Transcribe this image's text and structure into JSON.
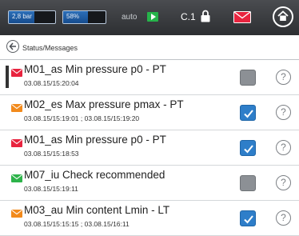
{
  "topbar": {
    "gauge1": {
      "label": "2,8 bar",
      "fill": 0.55
    },
    "gauge2": {
      "label": "58%",
      "fill": 0.58
    },
    "mode_label": "auto",
    "code_label": "C.1",
    "icons": [
      "play-icon",
      "lock-icon",
      "mail-alert-icon",
      "home-icon"
    ],
    "colors": {
      "bar": "#3a3c40",
      "gauge_fill": "#1e5aa2",
      "auto_green": "#26b34a",
      "alert_red": "#e8243f"
    }
  },
  "status": {
    "title": "Status/Messages"
  },
  "messages": [
    {
      "title": "M01_as Min pressure p0 - PT",
      "time": "03.08.15/15:20:04",
      "envelope": "red",
      "acknowledged": false,
      "selected": true
    },
    {
      "title": "M02_es Max pressure pmax - PT",
      "time": "03.08.15/15:19:01 ; 03.08.15/15:19:20",
      "envelope": "orange",
      "acknowledged": true,
      "selected": false
    },
    {
      "title": "M01_as Min pressure p0 - PT",
      "time": "03.08.15/15:18:53",
      "envelope": "red",
      "acknowledged": true,
      "selected": false
    },
    {
      "title": "M07_iu Check recommended",
      "time": "03.08.15/15:19:11",
      "envelope": "green",
      "acknowledged": false,
      "selected": false
    },
    {
      "title": "M03_au Min content Lmin - LT",
      "time": "03.08.15/15:15:15 ; 03.08.15/16:11",
      "envelope": "orange",
      "acknowledged": true,
      "selected": false
    }
  ],
  "help_symbol": "?",
  "envelope_colors": {
    "red": "#e8243f",
    "orange": "#f28a1c",
    "green": "#2db34a"
  }
}
